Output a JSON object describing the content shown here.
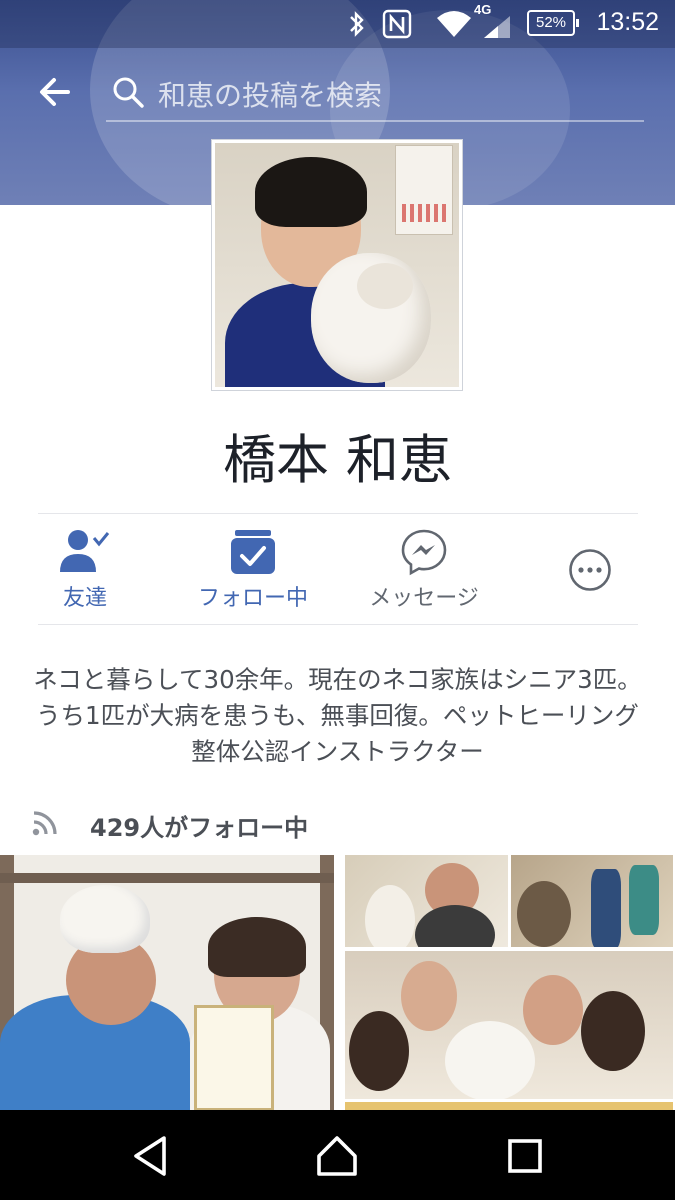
{
  "status_bar": {
    "time": "13:52",
    "battery": "52%",
    "network": "4G",
    "icons": [
      "bluetooth-icon",
      "nfc-icon",
      "wifi-icon",
      "signal-icon",
      "battery-icon"
    ]
  },
  "header": {
    "search_placeholder": "和恵の投稿を検索",
    "colors": {
      "cover": "#4a5f9f"
    }
  },
  "profile": {
    "name": "橋本 和恵",
    "bio": "ネコと暮らして30余年。現在のネコ家族はシニア3匹。うち1匹が大病を患うも、無事回復。ペットヒーリング整体公認インストラクター",
    "followers_text": "429人がフォロー中"
  },
  "actions": [
    {
      "label": "友達",
      "icon": "friend-check-icon",
      "color": "#4267b2"
    },
    {
      "label": "フォロー中",
      "icon": "following-check-icon",
      "color": "#4267b2"
    },
    {
      "label": "メッセージ",
      "icon": "messenger-icon",
      "color": "#616770"
    },
    {
      "label": "",
      "icon": "more-icon",
      "color": "#616770"
    }
  ],
  "nav": {
    "buttons": [
      "back-nav-icon",
      "home-nav-icon",
      "recents-nav-icon"
    ]
  }
}
